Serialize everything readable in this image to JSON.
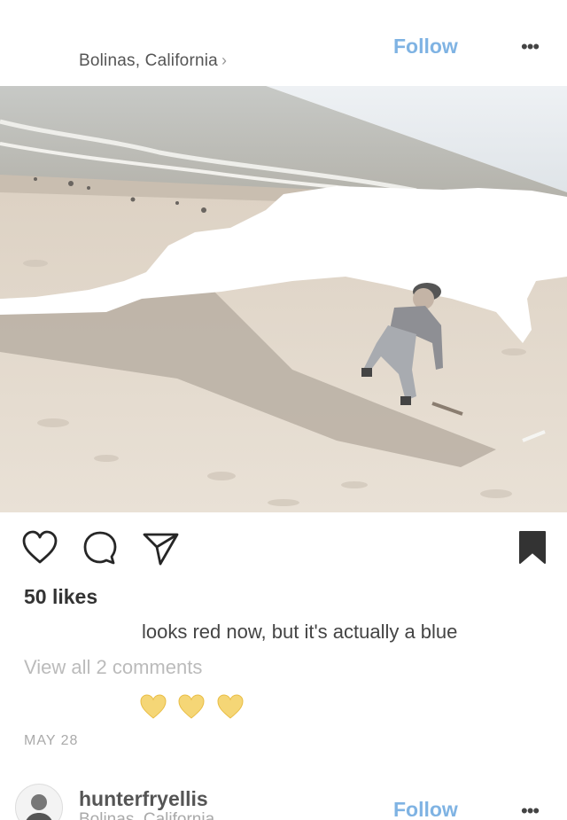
{
  "post": {
    "location": "Bolinas, California",
    "follow_label": "Follow",
    "more_label": "•••",
    "likes": "50 likes",
    "caption": "looks red now, but it's actually a blue",
    "view_comments": "View all 2 comments",
    "comment_emoji": "💛 💛 💛",
    "date": "MAY 28"
  },
  "next_post": {
    "username": "hunterfryellis",
    "location": "Bolinas, California",
    "follow_label": "Follow",
    "more_label": "•••"
  },
  "icons": {
    "actions": [
      "heart-icon",
      "comment-icon",
      "share-icon",
      "bookmark-icon"
    ]
  },
  "colors": {
    "follow": "#7fb3e3",
    "heart_emoji": "#f5d676"
  }
}
